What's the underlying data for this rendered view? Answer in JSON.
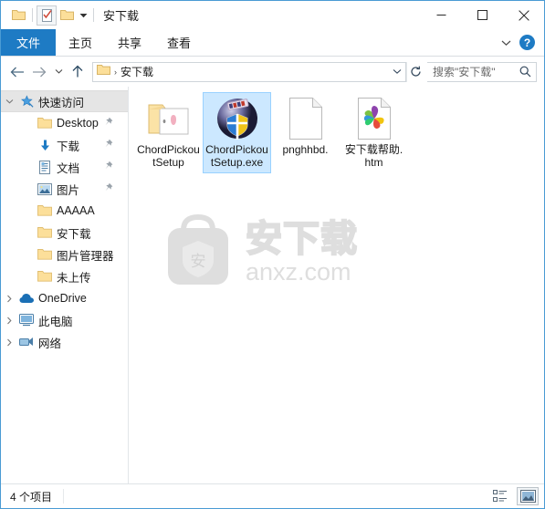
{
  "window": {
    "title": "安下载",
    "quick_access_toolbar": [
      {
        "name": "folder-icon",
        "tooltip": "安下载"
      },
      {
        "name": "properties-icon",
        "tooltip": "属性"
      },
      {
        "name": "new-folder-icon",
        "tooltip": "新建文件夹"
      }
    ],
    "controls": {
      "minimize": "最小化",
      "maximize": "最大化",
      "close": "关闭"
    }
  },
  "ribbon": {
    "tabs": [
      {
        "label": "文件",
        "active": true
      },
      {
        "label": "主页",
        "active": false
      },
      {
        "label": "共享",
        "active": false
      },
      {
        "label": "查看",
        "active": false
      }
    ],
    "expand_label": "展开功能区",
    "help_label": "?"
  },
  "navbar": {
    "back": "后退",
    "forward": "前进",
    "recent": "最近浏览的位置",
    "up": "上移到",
    "address": {
      "crumb_icon": "folder-icon",
      "crumb": "安下载",
      "separator": "›",
      "dropdown": "以前的位置",
      "refresh": "刷新"
    },
    "search": {
      "placeholder": "搜索\"安下载\"",
      "icon": "search-icon"
    }
  },
  "sidebar": {
    "items": [
      {
        "label": "快速访问",
        "icon": "star-pin-icon",
        "expander": "chevron-down",
        "indent": 0,
        "selected": true,
        "pinned": false
      },
      {
        "label": "Desktop",
        "icon": "folder-icon",
        "expander": "",
        "indent": 1,
        "selected": false,
        "pinned": true
      },
      {
        "label": "下载",
        "icon": "download-icon",
        "expander": "",
        "indent": 1,
        "selected": false,
        "pinned": true
      },
      {
        "label": "文档",
        "icon": "documents-icon",
        "expander": "",
        "indent": 1,
        "selected": false,
        "pinned": true
      },
      {
        "label": "图片",
        "icon": "pictures-icon",
        "expander": "",
        "indent": 1,
        "selected": false,
        "pinned": true
      },
      {
        "label": "AAAAA",
        "icon": "folder-icon",
        "expander": "",
        "indent": 1,
        "selected": false,
        "pinned": false
      },
      {
        "label": "安下载",
        "icon": "folder-icon",
        "expander": "",
        "indent": 1,
        "selected": false,
        "pinned": false
      },
      {
        "label": "图片管理器",
        "icon": "folder-icon",
        "expander": "",
        "indent": 1,
        "selected": false,
        "pinned": false
      },
      {
        "label": "未上传",
        "icon": "folder-icon",
        "expander": "",
        "indent": 1,
        "selected": false,
        "pinned": false
      },
      {
        "label": "OneDrive",
        "icon": "cloud-icon",
        "expander": "chevron-right",
        "indent": 0,
        "selected": false,
        "pinned": false
      },
      {
        "label": "此电脑",
        "icon": "computer-icon",
        "expander": "chevron-right",
        "indent": 0,
        "selected": false,
        "pinned": false
      },
      {
        "label": "网络",
        "icon": "network-icon",
        "expander": "chevron-right",
        "indent": 0,
        "selected": false,
        "pinned": false
      }
    ]
  },
  "files": {
    "items": [
      {
        "name": "ChordPickoutSetup",
        "icon": "open-folder-icon",
        "selected": false
      },
      {
        "name": "ChordPickoutSetup.exe",
        "icon": "installer-exe-icon",
        "selected": true
      },
      {
        "name": "pnghhbd.",
        "icon": "blank-document-icon",
        "selected": false
      },
      {
        "name": "安下载帮助.htm",
        "icon": "html-pinwheel-icon",
        "selected": false
      }
    ]
  },
  "watermark": {
    "logo": "安",
    "cn_text": "安下载",
    "en_text": "anxz.com"
  },
  "statusbar": {
    "item_count": "4 个项目",
    "views": [
      {
        "name": "details-view-icon",
        "label": "详细信息",
        "active": false
      },
      {
        "name": "large-icons-view-icon",
        "label": "大图标",
        "active": true
      }
    ]
  },
  "colors": {
    "accent": "#1e7bc4",
    "selection_fill": "#cce8ff",
    "selection_border": "#99d1ff",
    "window_border": "#4a9bd4",
    "folder_yellow": "#ffd98a"
  }
}
